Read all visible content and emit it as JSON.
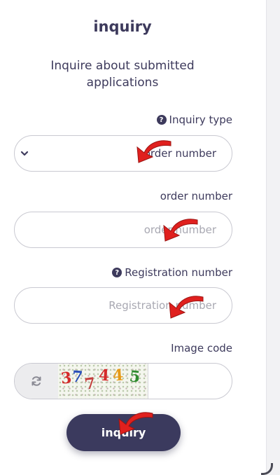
{
  "form": {
    "title": "inquiry",
    "subtitle": "Inquire about submitted applications",
    "inquiry_type": {
      "label": "Inquiry type",
      "help_icon": "question-circle-icon",
      "selected": "order number",
      "chevron_icon": "chevron-down-icon"
    },
    "order_number": {
      "label": "order number",
      "placeholder": "order number"
    },
    "registration_number": {
      "label": "Registration number",
      "help_icon": "question-circle-icon",
      "placeholder": "Registration number"
    },
    "image_code": {
      "label": "Image code",
      "refresh_icon": "refresh-icon",
      "captcha_chars": [
        "3",
        "7",
        "7",
        "4",
        "4",
        "5"
      ],
      "captcha_colors": [
        "#d42a2a",
        "#2a4fb8",
        "#c33d3d",
        "#d42a2a",
        "#e59a17",
        "#2e8a2e"
      ],
      "value": ""
    },
    "submit_label": "inquiry"
  },
  "colors": {
    "text": "#3d3a5c",
    "button": "#3b3a5e",
    "pointer_arrow": "#e0201e"
  }
}
